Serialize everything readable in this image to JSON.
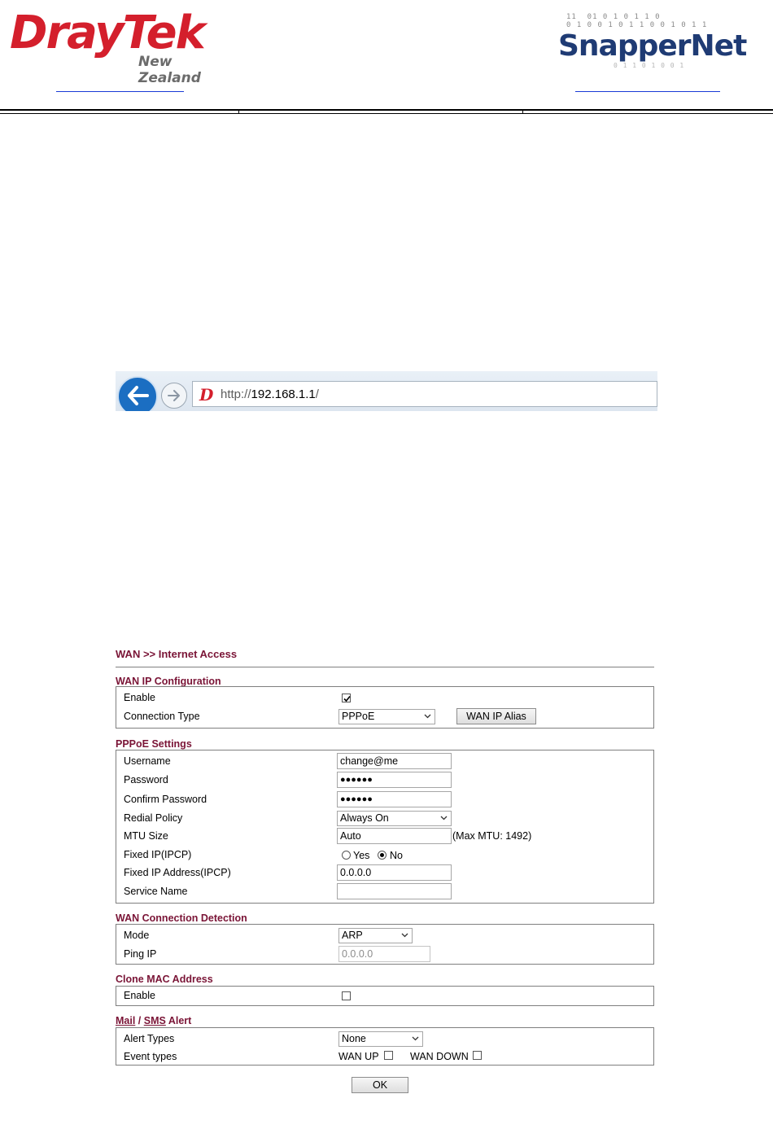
{
  "header": {
    "left_logo": {
      "brand": "DrayTek",
      "subtitle": "New Zealand"
    },
    "right_logo": {
      "brand": "SnapperNet",
      "decor_bits_top": "11  01 0 1 0 1 1 0\n0 1 0 0 1 0 1 1 0 0 1 0 1 1",
      "decor_bits_bottom": "0 1 1 0 1 0 0 1"
    }
  },
  "browser": {
    "url_scheme": "http://",
    "url_host": "192.168.1.1",
    "url_trail": "/",
    "favicon": "D",
    "icons": {
      "back": "back-arrow-icon",
      "forward": "forward-arrow-icon"
    }
  },
  "form": {
    "page_title": "WAN >> Internet Access",
    "wan_ip": {
      "title": "WAN IP Configuration",
      "enable_label": "Enable",
      "enable_checked": true,
      "conn_type_label": "Connection Type",
      "conn_type_value": "PPPoE",
      "alias_button": "WAN IP Alias"
    },
    "pppoe": {
      "title": "PPPoE Settings",
      "username_label": "Username",
      "username_value": "change@me",
      "password_label": "Password",
      "password_value": "●●●●●●",
      "confirm_label": "Confirm Password",
      "confirm_value": "●●●●●●",
      "redial_label": "Redial Policy",
      "redial_value": "Always On",
      "mtu_label": "MTU Size",
      "mtu_value": "Auto",
      "mtu_note": "(Max MTU: 1492)",
      "fixed_ip_label": "Fixed IP(IPCP)",
      "fixed_ip_yes": "Yes",
      "fixed_ip_no": "No",
      "fixed_ip_selected": "No",
      "fixed_addr_label": "Fixed IP Address(IPCP)",
      "fixed_addr_value": "0.0.0.0",
      "service_label": "Service Name",
      "service_value": ""
    },
    "detection": {
      "title": "WAN Connection Detection",
      "mode_label": "Mode",
      "mode_value": "ARP",
      "ping_label": "Ping IP",
      "ping_value": "0.0.0.0"
    },
    "clone_mac": {
      "title": "Clone MAC Address",
      "enable_label": "Enable",
      "enable_checked": false
    },
    "alert": {
      "title_mail": "Mail",
      "title_sep": " / ",
      "title_sms": "SMS",
      "title_rest": " Alert",
      "types_label": "Alert Types",
      "types_value": "None",
      "events_label": "Event types",
      "wan_up": "WAN UP",
      "wan_down": "WAN DOWN"
    },
    "ok_button": "OK"
  },
  "colors": {
    "section_title": "#7a1436",
    "draytek_red": "#d41f2c",
    "snapper_blue": "#1f3b74"
  }
}
